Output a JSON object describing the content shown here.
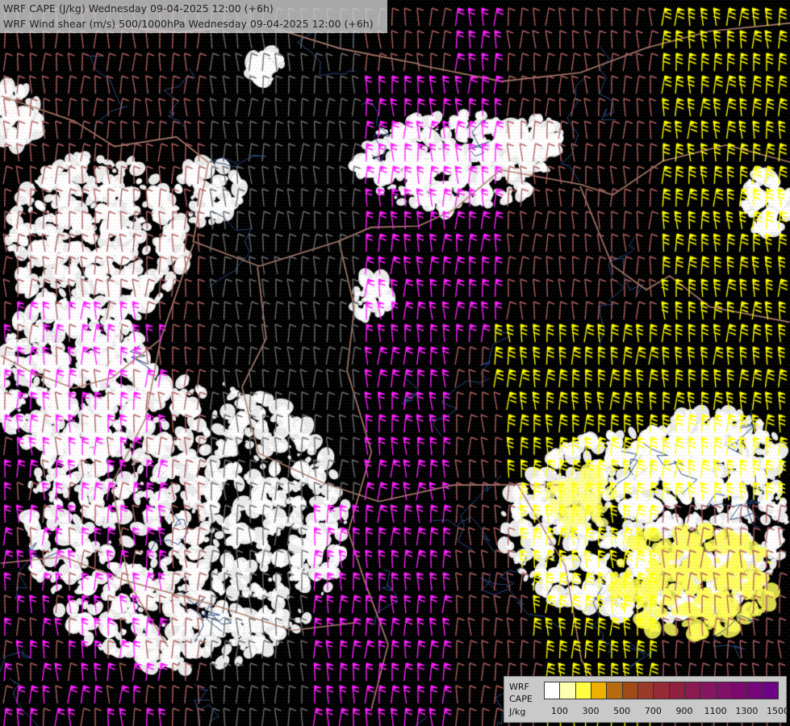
{
  "title": {
    "line1": "WRF CAPE (J/kg) Wednesday 09-04-2025 12:00 (+6h)",
    "line2": "WRF Wind shear (m/s) 500/1000hPa Wednesday 09-04-2025 12:00 (+6h)"
  },
  "legend": {
    "model": "WRF",
    "variable": "CAPE",
    "unit": "J/kg",
    "ticks": [
      "100",
      "300",
      "500",
      "700",
      "900",
      "1100",
      "1300",
      "1500"
    ],
    "colors": [
      "#ffffff",
      "#ffffb0",
      "#ffff40",
      "#f0b000",
      "#b86a10",
      "#a04a18",
      "#9a3a2a",
      "#962a36",
      "#902040",
      "#8a1a50",
      "#861660",
      "#801068",
      "#7a0a6e",
      "#74067a",
      "#6e0286"
    ]
  },
  "map": {
    "background": "#000000",
    "border_color": "#b08070",
    "river_color": "#2a4a80",
    "barb_colors": {
      "weak": "#6e6e6e",
      "moderate": "#b06060",
      "strong": "#e070c0",
      "very_strong": "#ff20ff",
      "extreme": "#ffff00",
      "tan": "#c8a060"
    }
  }
}
